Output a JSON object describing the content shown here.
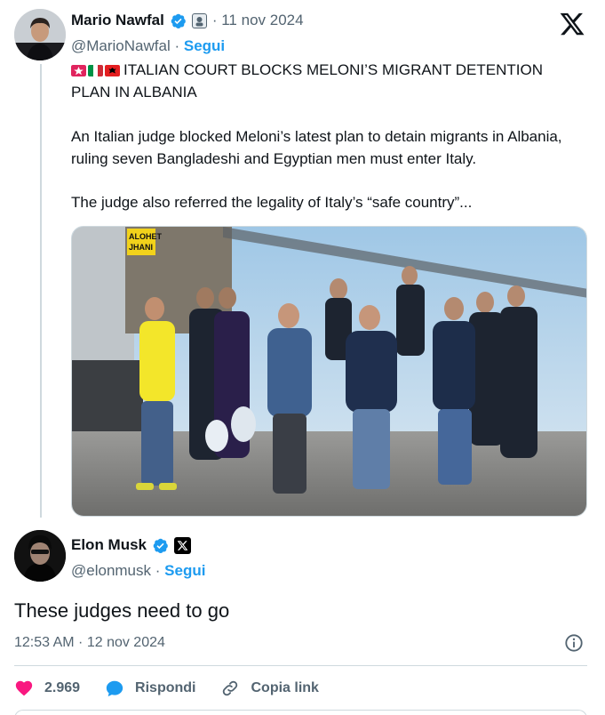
{
  "quoted_tweet": {
    "author_name": "Mario Nawfal",
    "date": "· 11 nov 2024",
    "handle": "@MarioNawfal",
    "separator": "·",
    "follow_label": "Segui",
    "headline": "ITALIAN COURT BLOCKS MELONI’S MIGRANT DETENTION PLAN IN ALBANIA",
    "paragraph_1": "An Italian judge blocked Meloni’s latest plan to detain migrants in Albania, ruling seven Bangladeshi and Egyptian men must enter Italy.",
    "paragraph_2": "The judge also referred the legality of Italy’s “safe country”...",
    "flag_icons": [
      "police-light-icon",
      "italy-flag-icon",
      "albania-flag-icon"
    ],
    "image_sign_text": [
      "ALOHET",
      "JHANI"
    ]
  },
  "main_tweet": {
    "author_name": "Elon Musk",
    "handle": "@elonmusk",
    "separator": "·",
    "follow_label": "Segui",
    "text": "These judges need to go",
    "timestamp": "12:53 AM · 12 nov 2024"
  },
  "actions": {
    "like_count": "2.969",
    "reply_label": "Rispondi",
    "copy_link_label": "Copia link"
  },
  "colors": {
    "accent": "#1d9bf0",
    "like": "#f91880",
    "text": "#0f1419",
    "muted": "#536471",
    "border": "#cfd9de"
  }
}
